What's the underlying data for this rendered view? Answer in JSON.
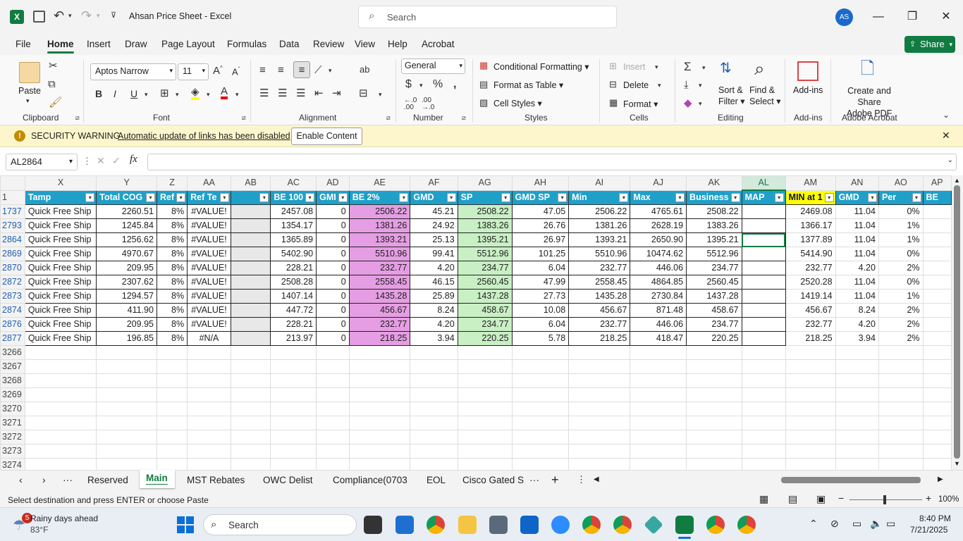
{
  "title": {
    "file_name": "Ahsan Price Sheet",
    "app_name": "Excel",
    "search_placeholder": "Search",
    "user_initials": "AS"
  },
  "menu": [
    "File",
    "Home",
    "Insert",
    "Draw",
    "Page Layout",
    "Formulas",
    "Data",
    "Review",
    "View",
    "Help",
    "Acrobat"
  ],
  "share_label": "Share",
  "ribbon": {
    "paste": "Paste",
    "font_name": "Aptos Narrow",
    "font_size": "11",
    "number_format": "General",
    "conditional_formatting": "Conditional Formatting",
    "format_as_table": "Format as Table",
    "cell_styles": "Cell Styles",
    "insert": "Insert",
    "delete": "Delete",
    "format": "Format",
    "sort_filter_1": "Sort &",
    "sort_filter_2": "Filter",
    "find_select_1": "Find &",
    "find_select_2": "Select",
    "addins": "Add-ins",
    "create_pdf_1": "Create and Share",
    "create_pdf_2": "Adobe PDF",
    "groups": {
      "clipboard": "Clipboard",
      "font": "Font",
      "alignment": "Alignment",
      "number": "Number",
      "styles": "Styles",
      "cells": "Cells",
      "editing": "Editing",
      "addins": "Add-ins",
      "acrobat": "Adobe Acrobat"
    }
  },
  "security": {
    "label": "SECURITY WARNING",
    "message": "Automatic update of links has been disabled",
    "button": "Enable Content"
  },
  "formula": {
    "name_box": "AL2864",
    "fx": "fx",
    "value": ""
  },
  "columns": [
    "X",
    "Y",
    "Z",
    "AA",
    "AB",
    "AC",
    "AD",
    "AE",
    "AF",
    "AG",
    "AH",
    "AI",
    "AJ",
    "AK",
    "AL",
    "AM",
    "AN",
    "AO",
    "AP"
  ],
  "header_row": {
    "row_no": "1",
    "cells": [
      "Tamp",
      "Total COG",
      "Ref",
      "Ref Te",
      "",
      "BE 100",
      "GMI",
      "BE 2%",
      "GMD",
      "SP",
      "GMD SP",
      "Min",
      "Max",
      "Business",
      "MAP",
      "MIN at 1",
      "GMD",
      "Per",
      "BE"
    ]
  },
  "rows": [
    {
      "rn": "1737",
      "c": [
        "Quick Free Ship",
        "2260.51",
        "8%",
        "#VALUE!",
        "",
        "2457.08",
        "0",
        "2506.22",
        "45.21",
        "2508.22",
        "47.05",
        "2506.22",
        "4765.61",
        "2508.22",
        "",
        "2469.08",
        "11.04",
        "0%",
        ""
      ]
    },
    {
      "rn": "2793",
      "c": [
        "Quick Free Ship",
        "1245.84",
        "8%",
        "#VALUE!",
        "",
        "1354.17",
        "0",
        "1381.26",
        "24.92",
        "1383.26",
        "26.76",
        "1381.26",
        "2628.19",
        "1383.26",
        "",
        "1366.17",
        "11.04",
        "1%",
        ""
      ]
    },
    {
      "rn": "2864",
      "c": [
        "Quick Free Ship",
        "1256.62",
        "8%",
        "#VALUE!",
        "",
        "1365.89",
        "0",
        "1393.21",
        "25.13",
        "1395.21",
        "26.97",
        "1393.21",
        "2650.90",
        "1395.21",
        "",
        "1377.89",
        "11.04",
        "1%",
        ""
      ]
    },
    {
      "rn": "2869",
      "c": [
        "Quick Free Ship",
        "4970.67",
        "8%",
        "#VALUE!",
        "",
        "5402.90",
        "0",
        "5510.96",
        "99.41",
        "5512.96",
        "101.25",
        "5510.96",
        "10474.62",
        "5512.96",
        "",
        "5414.90",
        "11.04",
        "0%",
        ""
      ]
    },
    {
      "rn": "2870",
      "c": [
        "Quick Free Ship",
        "209.95",
        "8%",
        "#VALUE!",
        "",
        "228.21",
        "0",
        "232.77",
        "4.20",
        "234.77",
        "6.04",
        "232.77",
        "446.06",
        "234.77",
        "",
        "232.77",
        "4.20",
        "2%",
        ""
      ]
    },
    {
      "rn": "2872",
      "c": [
        "Quick Free Ship",
        "2307.62",
        "8%",
        "#VALUE!",
        "",
        "2508.28",
        "0",
        "2558.45",
        "46.15",
        "2560.45",
        "47.99",
        "2558.45",
        "4864.85",
        "2560.45",
        "",
        "2520.28",
        "11.04",
        "0%",
        ""
      ]
    },
    {
      "rn": "2873",
      "c": [
        "Quick Free Ship",
        "1294.57",
        "8%",
        "#VALUE!",
        "",
        "1407.14",
        "0",
        "1435.28",
        "25.89",
        "1437.28",
        "27.73",
        "1435.28",
        "2730.84",
        "1437.28",
        "",
        "1419.14",
        "11.04",
        "1%",
        ""
      ]
    },
    {
      "rn": "2874",
      "c": [
        "Quick Free Ship",
        "411.90",
        "8%",
        "#VALUE!",
        "",
        "447.72",
        "0",
        "456.67",
        "8.24",
        "458.67",
        "10.08",
        "456.67",
        "871.48",
        "458.67",
        "",
        "456.67",
        "8.24",
        "2%",
        ""
      ]
    },
    {
      "rn": "2876",
      "c": [
        "Quick Free Ship",
        "209.95",
        "8%",
        "#VALUE!",
        "",
        "228.21",
        "0",
        "232.77",
        "4.20",
        "234.77",
        "6.04",
        "232.77",
        "446.06",
        "234.77",
        "",
        "232.77",
        "4.20",
        "2%",
        ""
      ]
    },
    {
      "rn": "2877",
      "c": [
        "Quick Free Ship",
        "196.85",
        "8%",
        "#N/A",
        "",
        "213.97",
        "0",
        "218.25",
        "3.94",
        "220.25",
        "5.78",
        "218.25",
        "418.47",
        "220.25",
        "",
        "218.25",
        "3.94",
        "2%",
        ""
      ]
    }
  ],
  "empty_rows": [
    "3266",
    "3267",
    "3268",
    "3269",
    "3270",
    "3271",
    "3272",
    "3273",
    "3274"
  ],
  "sheet_tabs": [
    "Reserved",
    "Main",
    "MST Rebates",
    "OWC Delist",
    "Compliance(0703",
    "EOL",
    "Cisco Gated S"
  ],
  "status": {
    "message": "Select destination and press ENTER or choose Paste",
    "zoom": "100%"
  },
  "taskbar": {
    "weather_title": "Rainy days ahead",
    "weather_temp": "83°F",
    "weather_badge": "5",
    "search_placeholder": "Search",
    "time": "8:40 PM",
    "date": "7/21/2025"
  },
  "colors": {
    "excel_green": "#107c41",
    "header_blue": "#1fa0c9",
    "pink": "#e59ee3",
    "light_green": "#c9efc5",
    "yellow": "#ffff00"
  }
}
